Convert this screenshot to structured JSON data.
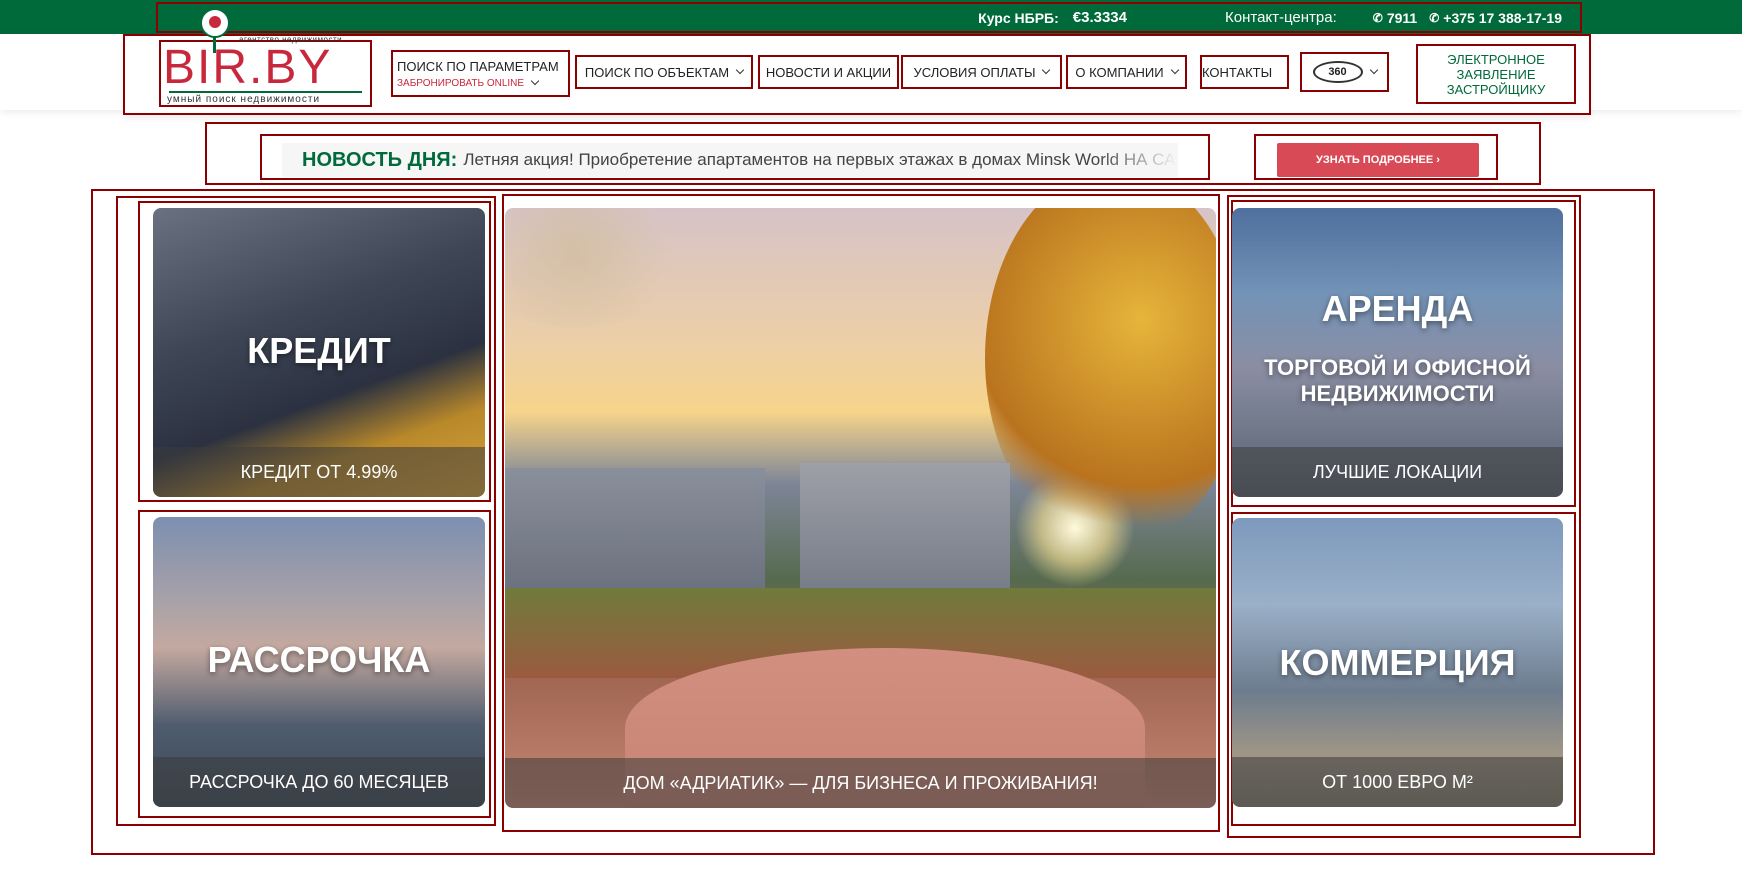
{
  "topbar": {
    "rate_label": "Курс НБРБ:",
    "rate_value": "€3.3334",
    "contact_label": "Контакт-центра:",
    "phones": [
      "7911",
      "+375 17 388-17-19"
    ]
  },
  "logo": {
    "subtitle": "агентство недвижимости",
    "text": "BIR.BY",
    "tagline": "умный поиск недвижимости"
  },
  "nav": {
    "search_label": "ПОИСК ПО ПАРАМЕТРАМ",
    "book_label": "ЗАБРОНИРОВАТЬ ONLINE",
    "objects_label": "ПОИСК ПО ОБЪЕКТАМ",
    "news_label": "НОВОСТИ И АКЦИИ",
    "payment_label": "УСЛОВИЯ ОПЛАТЫ",
    "about_label": "О КОМПАНИИ",
    "contacts_label": "КОНТАКТЫ",
    "tour_label": "360",
    "application_label": "ЭЛЕКТРОННОЕ ЗАЯВЛЕНИЕ ЗАСТРОЙЩИКУ"
  },
  "news": {
    "label": "НОВОСТЬ ДНЯ:",
    "text": "Летняя акция! Приобретение апартаментов на первых этажах в домах Minsk World НА СА",
    "more_label": "УЗНАТЬ ПОДРОБНЕЕ ›"
  },
  "cards": {
    "credit": {
      "title": "КРЕДИТ",
      "footer": "КРЕДИТ ОТ 4.99%"
    },
    "installment": {
      "title": "РАССРОЧКА",
      "footer": "РАССРОЧКА ДО 60 МЕСЯЦЕВ"
    },
    "adriatic": {
      "footer": "ДОМ «АДРИАТИК» — ДЛЯ БИЗНЕСА И ПРОЖИВАНИЯ!"
    },
    "rent": {
      "title": "АРЕНДА",
      "subtitle": "ТОРГОВОЙ И ОФИСНОЙ НЕДВИЖИМОСТИ",
      "footer": "ЛУЧШИЕ ЛОКАЦИИ"
    },
    "commerce": {
      "title": "КОММЕРЦИЯ",
      "footer": "ОТ 1000 ЕВРО М²"
    }
  },
  "colors": {
    "brand_green": "#006a3a",
    "brand_red": "#c8283c",
    "button_red": "#d94a57",
    "annotation_frame": "#8b0000"
  },
  "icons": {
    "phone": "phone-icon",
    "chevron": "chevron-down-icon",
    "tour": "360-icon",
    "pin": "location-pin-icon"
  }
}
